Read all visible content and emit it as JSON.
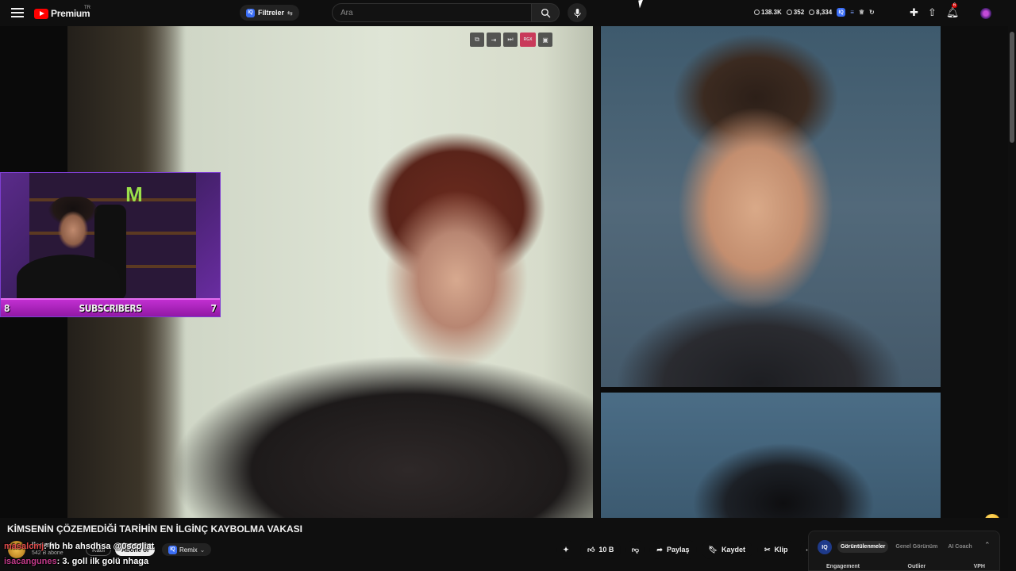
{
  "header": {
    "logo_text": "Premium",
    "region": "TR",
    "filter_label": "Filtreler",
    "search_placeholder": "Ara",
    "stats": [
      {
        "icon": "eye-icon",
        "value": "138.3K"
      },
      {
        "icon": "eye-icon",
        "value": "352"
      },
      {
        "icon": "eye-icon",
        "value": "8,334"
      }
    ],
    "notification_count": "6"
  },
  "webcam": {
    "left_count": "8",
    "label": "SUBSCRIBERS",
    "right_count": "7",
    "brand_glyph": "M"
  },
  "video_controls": {
    "rec_label": "RGX"
  },
  "video": {
    "title": "KİMSENİN ÇÖZEMEDİĞİ TARİHİN EN İLGİNÇ KAYBOLMA VAKASI"
  },
  "channel": {
    "name": "Ilesmix",
    "subs": "542 B abone",
    "join_label": "Katıl",
    "subscribe_label": "Abone ol",
    "remix_label": "Remix"
  },
  "chat": [
    {
      "user": "masalcmj",
      "message": ": hb hb ahsdhsa @0scoliat"
    },
    {
      "user": "isacangunes",
      "message": ": 3. goll ilk golü nhaga"
    }
  ],
  "actions": {
    "like_count": "10 B",
    "share_label": "Paylaş",
    "save_label": "Kaydet",
    "clip_label": "Klip"
  },
  "side_panel": {
    "tabs": [
      "Görüntülenmeler",
      "Genel Görünüm",
      "AI Coach"
    ],
    "columns": [
      "Engagement",
      "Outlier",
      "VPH"
    ]
  },
  "colors": {
    "brand": "#ff0000",
    "webcam_bar": "#b023c4",
    "accent": "#3b6ef5"
  }
}
